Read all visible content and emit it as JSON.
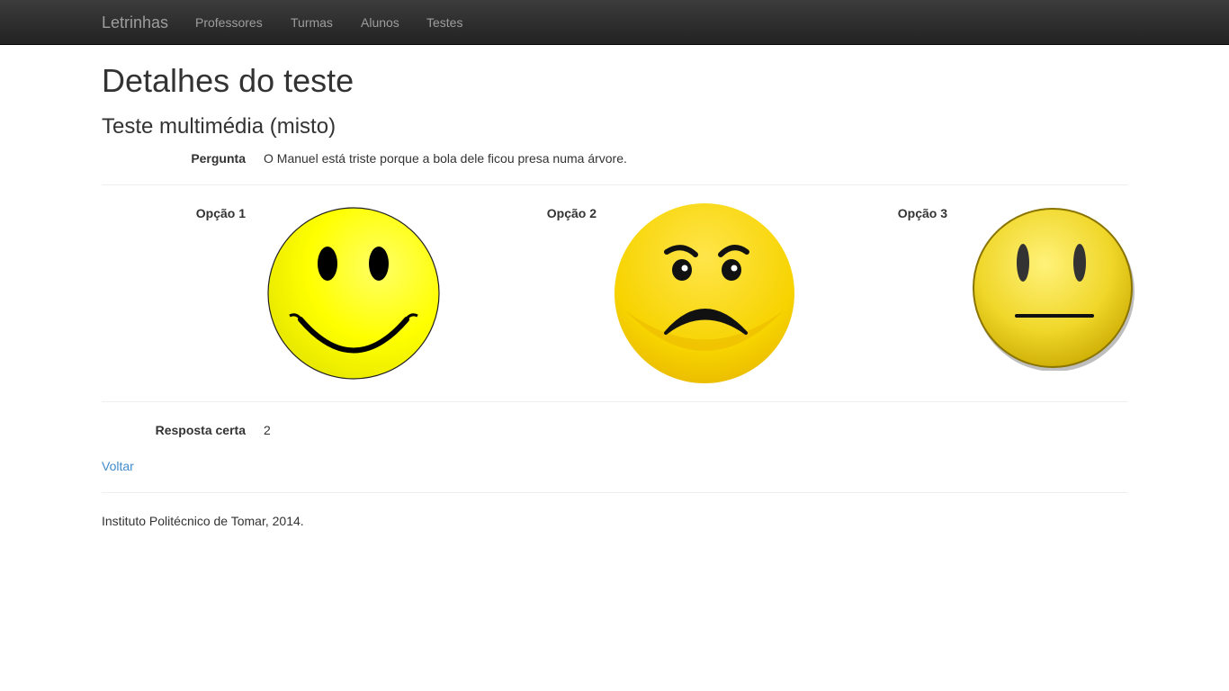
{
  "navbar": {
    "brand": "Letrinhas",
    "items": [
      {
        "label": "Professores"
      },
      {
        "label": "Turmas"
      },
      {
        "label": "Alunos"
      },
      {
        "label": "Testes"
      }
    ]
  },
  "page": {
    "title": "Detalhes do teste",
    "subtitle": "Teste multimédia (misto)"
  },
  "question": {
    "label": "Pergunta",
    "text": "O Manuel está triste porque a bola dele ficou presa numa árvore."
  },
  "options": [
    {
      "label": "Opção 1",
      "icon": "happy-face-icon"
    },
    {
      "label": "Opção 2",
      "icon": "sad-face-icon"
    },
    {
      "label": "Opção 3",
      "icon": "neutral-face-icon"
    }
  ],
  "answer": {
    "label": "Resposta certa",
    "value": "2"
  },
  "back_link": "Voltar",
  "footer": "Instituto Politécnico de Tomar, 2014.",
  "colors": {
    "navbar": "#222222",
    "link": "#428bca",
    "face_yellow": "#ffff00",
    "face_gold": "#f5d000"
  }
}
